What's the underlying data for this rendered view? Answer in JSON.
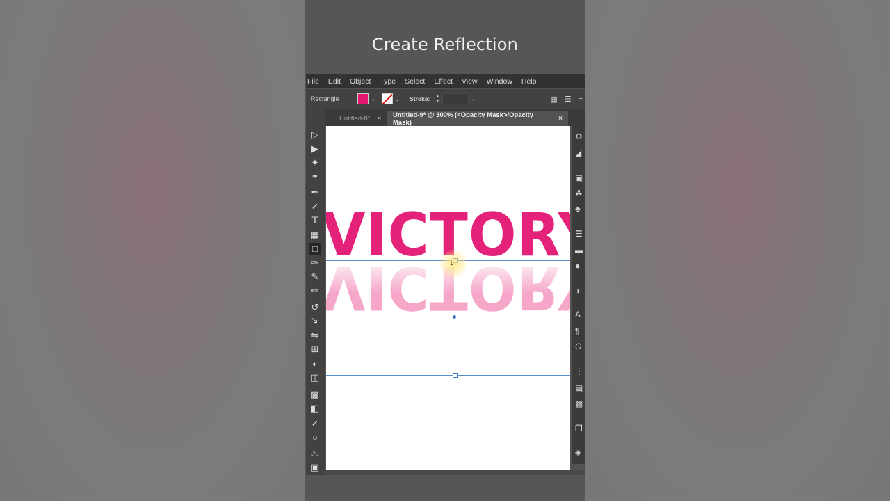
{
  "overlay": {
    "title": "Create Reflection"
  },
  "menubar": {
    "items": [
      "File",
      "Edit",
      "Object",
      "Type",
      "Select",
      "Effect",
      "View",
      "Window",
      "Help"
    ]
  },
  "controlbar": {
    "selection_label": "Rectangle",
    "stroke_label": "Stroke:",
    "fill_color": "#e5186f"
  },
  "tabs": [
    {
      "label": "Untitled-8*",
      "active": false
    },
    {
      "label": "Untitled-9* @ 300% (<Opacity Mask>/Opacity Mask)",
      "active": true
    }
  ],
  "toolbar": {
    "tools": [
      "selection-tool-icon",
      "direct-selection-tool-icon",
      "magic-wand-tool-icon",
      "lasso-tool-icon",
      "pen-tool-icon",
      "curvature-tool-icon",
      "type-tool-icon",
      "grid-tool-icon",
      "rectangle-tool-icon",
      "paintbrush-tool-icon",
      "pencil-tool-icon",
      "eraser-tool-icon",
      "rotate-tool-icon",
      "scale-tool-icon",
      "width-tool-icon",
      "free-transform-tool-icon",
      "shape-builder-tool-icon",
      "perspective-grid-tool-icon",
      "mesh-tool-icon",
      "gradient-tool-icon",
      "eyedropper-tool-icon",
      "blend-tool-icon",
      "symbol-sprayer-tool-icon",
      "column-graph-tool-icon"
    ],
    "active": "rectangle-tool-icon"
  },
  "artwork": {
    "text": "VICTORY",
    "text_color": "#e5227a",
    "reflection_color": "#f5a6c9"
  }
}
